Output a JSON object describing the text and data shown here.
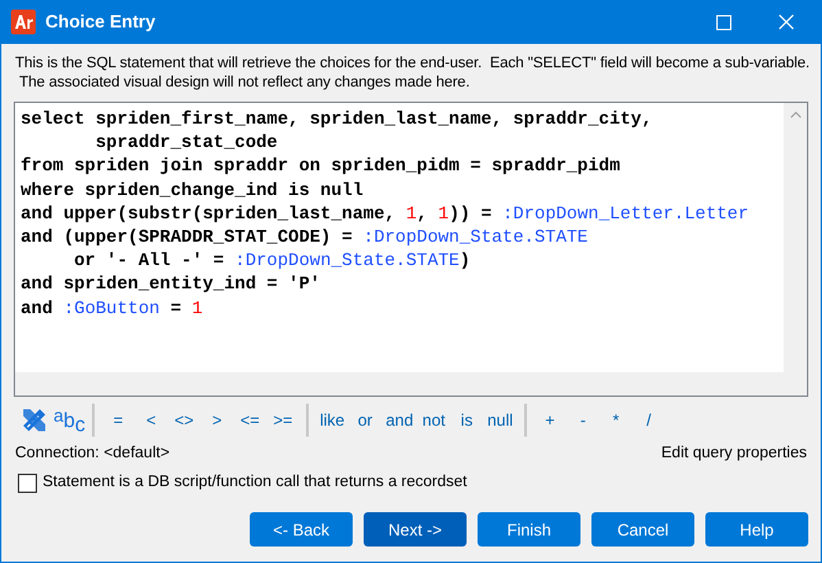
{
  "window": {
    "title": "Choice Entry"
  },
  "description": [
    "This is the SQL statement that will retrieve the choices for the end-user.  Each \"SELECT\" field will become a sub-variable.",
    "The associated visual design will not reflect any changes made here."
  ],
  "sql_lines": [
    [
      {
        "kind": "text",
        "text": "select spriden_first_name, spriden_last_name, spraddr_city,"
      }
    ],
    [
      {
        "kind": "text",
        "text": "       spraddr_stat_code"
      }
    ],
    [
      {
        "kind": "text",
        "text": "from spriden join spraddr on spriden_pidm = spraddr_pidm"
      }
    ],
    [
      {
        "kind": "text",
        "text": "where spriden_change_ind is null"
      }
    ],
    [
      {
        "kind": "text",
        "text": "and upper(substr(spriden_last_name, "
      },
      {
        "kind": "number",
        "text": "1"
      },
      {
        "kind": "text",
        "text": ", "
      },
      {
        "kind": "number",
        "text": "1"
      },
      {
        "kind": "text",
        "text": ")) = "
      },
      {
        "kind": "param",
        "text": ":DropDown_Letter.Letter"
      }
    ],
    [
      {
        "kind": "text",
        "text": "and (upper(SPRADDR_STAT_CODE) = "
      },
      {
        "kind": "param",
        "text": ":DropDown_State.STATE"
      }
    ],
    [
      {
        "kind": "text",
        "text": "     or '- All -' = "
      },
      {
        "kind": "param",
        "text": ":DropDown_State.STATE"
      },
      {
        "kind": "text",
        "text": ")"
      }
    ],
    [
      {
        "kind": "text",
        "text": "and spriden_entity_ind = 'P'"
      }
    ],
    [
      {
        "kind": "text",
        "text": "and "
      },
      {
        "kind": "param",
        "text": ":GoButton"
      },
      {
        "kind": "text",
        "text": " = "
      },
      {
        "kind": "number",
        "text": "1"
      }
    ]
  ],
  "toolbar_groups": [
    [
      "=",
      "<",
      "<>",
      ">",
      "<=",
      ">="
    ],
    [
      "like",
      "or",
      "and",
      "not",
      "is",
      "null"
    ],
    [
      "+",
      "-",
      "*",
      "/"
    ]
  ],
  "format_icon_letters": [
    "a",
    "b",
    "c"
  ],
  "connection": "Connection: <default>",
  "edit_link": "Edit query properties",
  "db_script_checkbox": {
    "label": "Statement is a DB script/function call that returns a recordset",
    "checked": false
  },
  "buttons": [
    {
      "label": "<- Back",
      "default": false
    },
    {
      "label": "Next ->",
      "default": true
    },
    {
      "label": "Finish",
      "default": false
    },
    {
      "label": "Cancel",
      "default": false
    },
    {
      "label": "Help",
      "default": false
    }
  ]
}
